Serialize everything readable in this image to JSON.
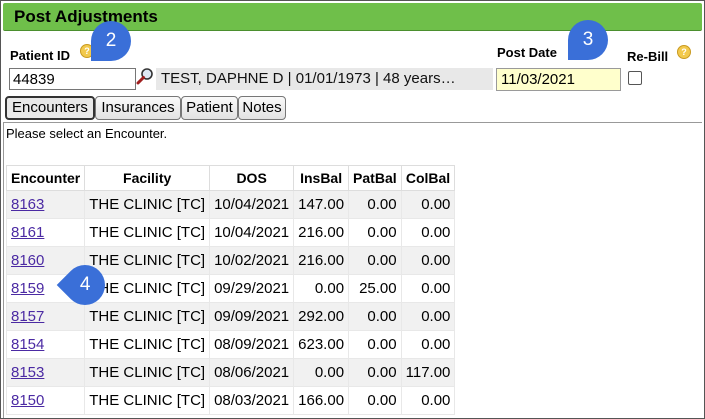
{
  "window": {
    "title": "Post Adjustments"
  },
  "patient": {
    "id_label": "Patient ID",
    "id_value": "44839",
    "info": "TEST, DAPHNE D | 01/01/1973 | 48 years…"
  },
  "post_date": {
    "label": "Post Date",
    "value": "11/03/2021"
  },
  "rebill": {
    "label": "Re-Bill",
    "checked": false
  },
  "help_glyph": "?",
  "tabs": [
    {
      "label": "Encounters",
      "active": true
    },
    {
      "label": "Insurances"
    },
    {
      "label": "Patient"
    },
    {
      "label": "Notes"
    }
  ],
  "message": "Please select an Encounter.",
  "table": {
    "headers": [
      "Encounter",
      "Facility",
      "DOS",
      "InsBal",
      "PatBal",
      "ColBal"
    ],
    "rows": [
      [
        "8163",
        "THE CLINIC [TC]",
        "10/04/2021",
        "147.00",
        "0.00",
        "0.00"
      ],
      [
        "8161",
        "THE CLINIC [TC]",
        "10/04/2021",
        "216.00",
        "0.00",
        "0.00"
      ],
      [
        "8160",
        "THE CLINIC [TC]",
        "10/02/2021",
        "216.00",
        "0.00",
        "0.00"
      ],
      [
        "8159",
        "THE CLINIC [TC]",
        "09/29/2021",
        "0.00",
        "25.00",
        "0.00"
      ],
      [
        "8157",
        "THE CLINIC [TC]",
        "09/09/2021",
        "292.00",
        "0.00",
        "0.00"
      ],
      [
        "8154",
        "THE CLINIC [TC]",
        "08/09/2021",
        "623.00",
        "0.00",
        "0.00"
      ],
      [
        "8153",
        "THE CLINIC [TC]",
        "08/06/2021",
        "0.00",
        "0.00",
        "117.00"
      ],
      [
        "8150",
        "THE CLINIC [TC]",
        "08/03/2021",
        "166.00",
        "0.00",
        "0.00"
      ]
    ]
  },
  "callouts": [
    "2",
    "3",
    "4"
  ],
  "colors": {
    "titlebar": "#6fbf4a",
    "date_bg": "#ffffcc",
    "link": "#4b2aa3",
    "callout": "#3a6fd8"
  }
}
